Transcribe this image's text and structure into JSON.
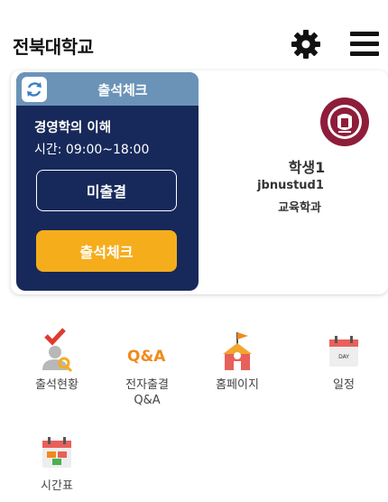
{
  "header": {
    "title": "전북대학교"
  },
  "attendance": {
    "title": "출석체크",
    "course": "경영학의 이해",
    "time": "시간: 09:00~18:00",
    "status_button": "미출결",
    "check_button": "출석체크",
    "colors": {
      "card": "#17295a",
      "header": "#6b93b8",
      "check": "#f5ad1c"
    }
  },
  "student": {
    "name": "학생1",
    "id": "jbnustud1",
    "department": "교육학과"
  },
  "menu": [
    {
      "label": "출석현황",
      "icon": "attendance-status-icon"
    },
    {
      "label": "전자출결\nQ&A",
      "icon": "qna-icon"
    },
    {
      "label": "홈페이지",
      "icon": "homepage-icon"
    },
    {
      "label": "일정",
      "icon": "calendar-icon"
    },
    {
      "label": "시간표",
      "icon": "timetable-icon"
    }
  ]
}
